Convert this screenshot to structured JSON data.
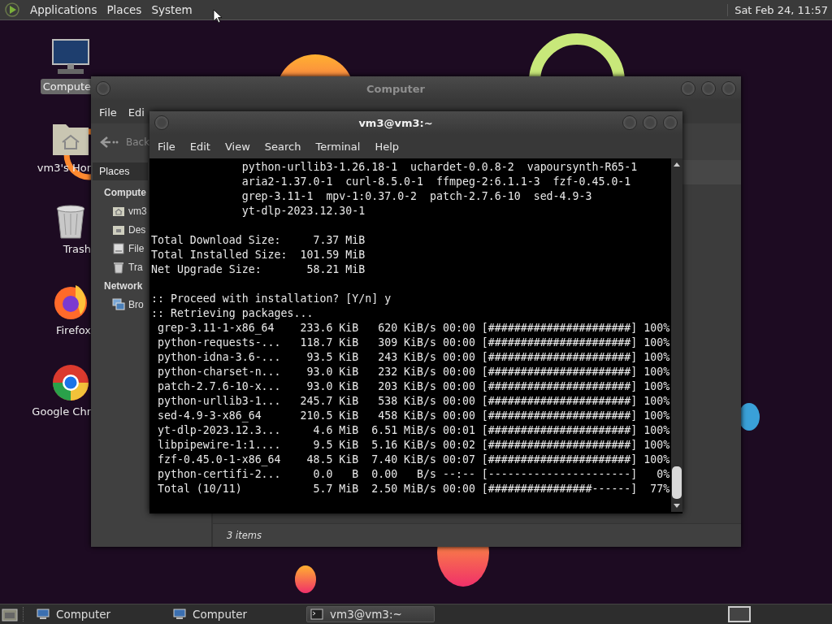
{
  "top_panel": {
    "menus": [
      "Applications",
      "Places",
      "System"
    ],
    "clock": "Sat Feb 24, 11:57"
  },
  "desktop_icons": [
    {
      "label": "Compute",
      "kind": "computer",
      "selected": true
    },
    {
      "label": "vm3's Hor",
      "kind": "home",
      "selected": false
    },
    {
      "label": "Trash",
      "kind": "trash",
      "selected": false
    },
    {
      "label": "Firefox",
      "kind": "firefox",
      "selected": false
    },
    {
      "label": "Google Chr",
      "kind": "chrome",
      "selected": false
    }
  ],
  "file_manager": {
    "title": "Computer",
    "menus": [
      "File",
      "Edi"
    ],
    "back": "Back",
    "sidebar": {
      "tab": "Places",
      "sections": [
        {
          "heading": "Compute",
          "items": [
            {
              "label": "vm3",
              "kind": "home"
            },
            {
              "label": "Des",
              "kind": "desktop"
            },
            {
              "label": "File",
              "kind": "drive"
            },
            {
              "label": "Tra",
              "kind": "trash"
            }
          ]
        },
        {
          "heading": "Network",
          "items": [
            {
              "label": "Bro",
              "kind": "network"
            }
          ]
        }
      ]
    },
    "status": "3 items"
  },
  "terminal": {
    "title": "vm3@vm3:~",
    "menus": [
      "File",
      "Edit",
      "View",
      "Search",
      "Terminal",
      "Help"
    ],
    "blocks": [
      [
        "              python-urllib3-1.26.18-1  uchardet-0.0.8-2  vapoursynth-R65-1",
        "              aria2-1.37.0-1  curl-8.5.0-1  ffmpeg-2:6.1.1-3  fzf-0.45.0-1",
        "              grep-3.11-1  mpv-1:0.37.0-2  patch-2.7.6-10  sed-4.9-3",
        "              yt-dlp-2023.12.30-1"
      ],
      [
        "Total Download Size:     7.37 MiB",
        "Total Installed Size:  101.59 MiB",
        "Net Upgrade Size:       58.21 MiB"
      ],
      [
        ":: Proceed with installation? [Y/n] y",
        ":: Retrieving packages...",
        " grep-3.11-1-x86_64    233.6 KiB   620 KiB/s 00:00 [######################] 100%",
        " python-requests-...   118.7 KiB   309 KiB/s 00:00 [######################] 100%",
        " python-idna-3.6-...    93.5 KiB   243 KiB/s 00:00 [######################] 100%",
        " python-charset-n...    93.0 KiB   232 KiB/s 00:00 [######################] 100%",
        " patch-2.7.6-10-x...    93.0 KiB   203 KiB/s 00:00 [######################] 100%",
        " python-urllib3-1...   245.7 KiB   538 KiB/s 00:00 [######################] 100%",
        " sed-4.9-3-x86_64      210.5 KiB   458 KiB/s 00:00 [######################] 100%",
        " yt-dlp-2023.12.3...     4.6 MiB  6.51 MiB/s 00:01 [######################] 100%",
        " libpipewire-1:1....     9.5 KiB  5.16 KiB/s 00:02 [######################] 100%",
        " fzf-0.45.0-1-x86_64    48.5 KiB  7.40 KiB/s 00:07 [######################] 100%",
        " python-certifi-2...     0.0   B  0.00   B/s --:-- [----------------------]   0%",
        " Total (10/11)           5.7 MiB  2.50 MiB/s 00:00 [################------]  77%"
      ]
    ]
  },
  "taskbar": {
    "items": [
      {
        "label": "Computer",
        "kind": "computer",
        "selected": false
      },
      {
        "label": "Computer",
        "kind": "computer",
        "selected": false
      },
      {
        "label": "vm3@vm3:~",
        "kind": "terminal",
        "selected": true
      }
    ]
  }
}
